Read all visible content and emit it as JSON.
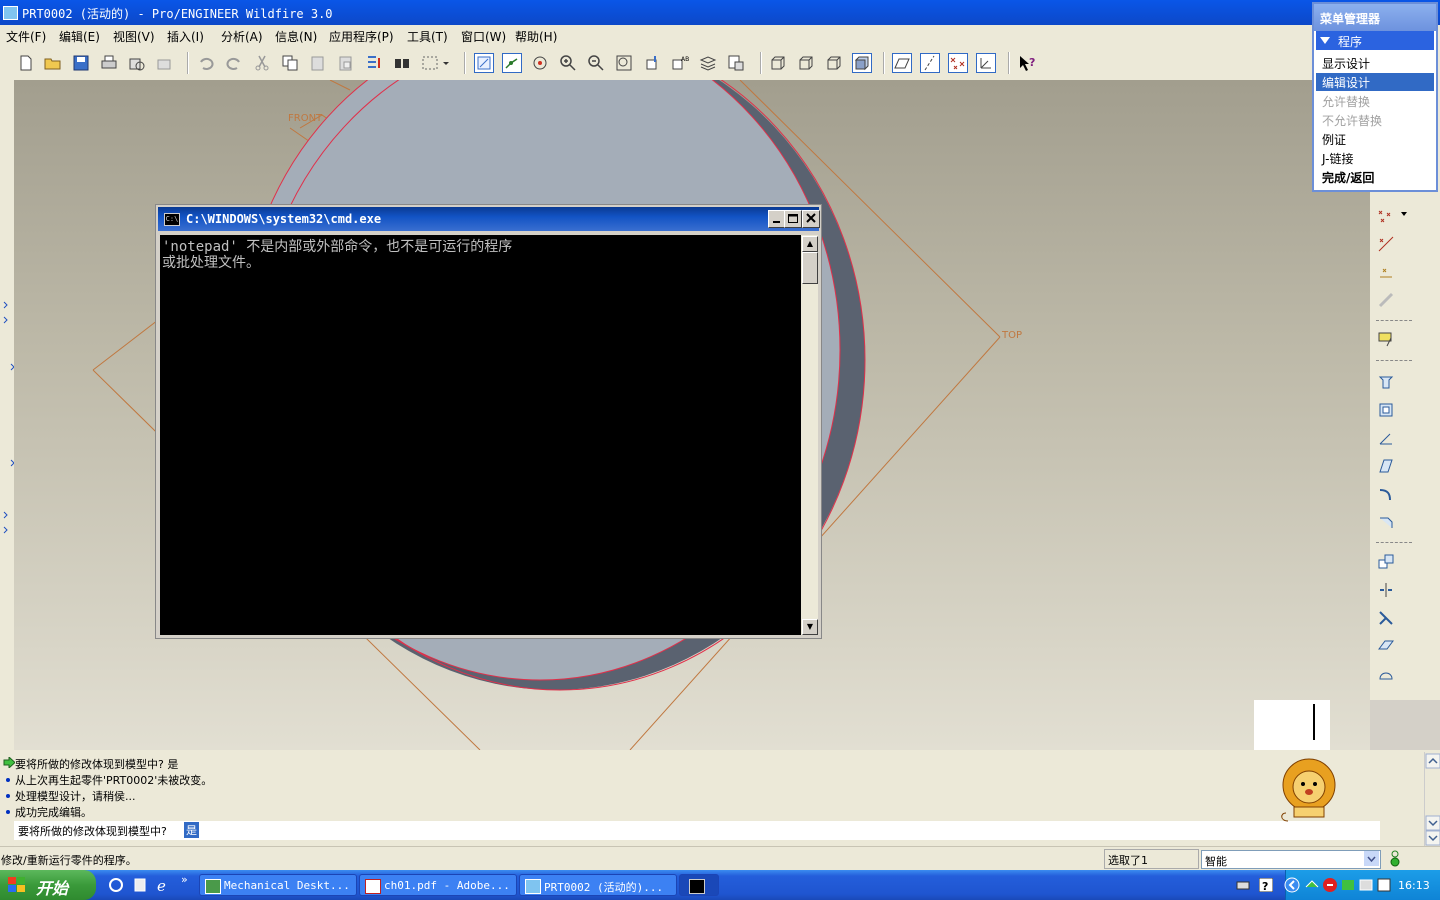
{
  "window": {
    "title": "PRT0002 (活动的) - Pro/ENGINEER Wildfire 3.0"
  },
  "menubar": [
    "文件(F)",
    "编辑(E)",
    "视图(V)",
    "插入(I)",
    "分析(A)",
    "信息(N)",
    "应用程序(P)",
    "工具(T)",
    "窗口(W)",
    "帮助(H)"
  ],
  "datums": {
    "front": "FRONT",
    "top": "TOP"
  },
  "menu_manager": {
    "title": "菜单管理器",
    "header": "程序",
    "items": [
      {
        "label": "显示设计",
        "state": "normal"
      },
      {
        "label": "编辑设计",
        "state": "selected"
      },
      {
        "label": "允许替换",
        "state": "disabled"
      },
      {
        "label": "不允许替换",
        "state": "disabled"
      },
      {
        "label": "例证",
        "state": "normal"
      },
      {
        "label": "J-链接",
        "state": "normal"
      },
      {
        "label": "完成/返回",
        "state": "bold"
      }
    ]
  },
  "cmd_window": {
    "title": "C:\\WINDOWS\\system32\\cmd.exe",
    "icon_label": "C:\\",
    "lines": [
      "'notepad' 不是内部或外部命令，也不是可运行的程序",
      "或批处理文件。"
    ]
  },
  "messages": {
    "lines": [
      {
        "text": "要将所做的修改体现到模型中?     是",
        "marker": "arrow"
      },
      {
        "text": "从上次再生起零件'PRT0002'未被改变。",
        "marker": "dot"
      },
      {
        "text": "处理模型设计，请稍侯...",
        "marker": "dot"
      },
      {
        "text": "成功完成编辑。",
        "marker": "dot"
      }
    ],
    "prompt": "要将所做的修改体现到模型中?",
    "prompt_value": "是"
  },
  "status": {
    "left": "修改/重新运行零件的程序。",
    "selected": "选取了1",
    "filter": "智能"
  },
  "taskbar": {
    "start": "开始",
    "tasks": [
      "Mechanical Deskt...",
      "ch01.pdf - Adobe...",
      "PRT0002 (活动的)..."
    ],
    "clock": "16:13"
  },
  "colors": {
    "titlebar": "#0a56e8",
    "selection": "#316ac5",
    "datum": "#c06a30",
    "edge": "#e0304a"
  }
}
